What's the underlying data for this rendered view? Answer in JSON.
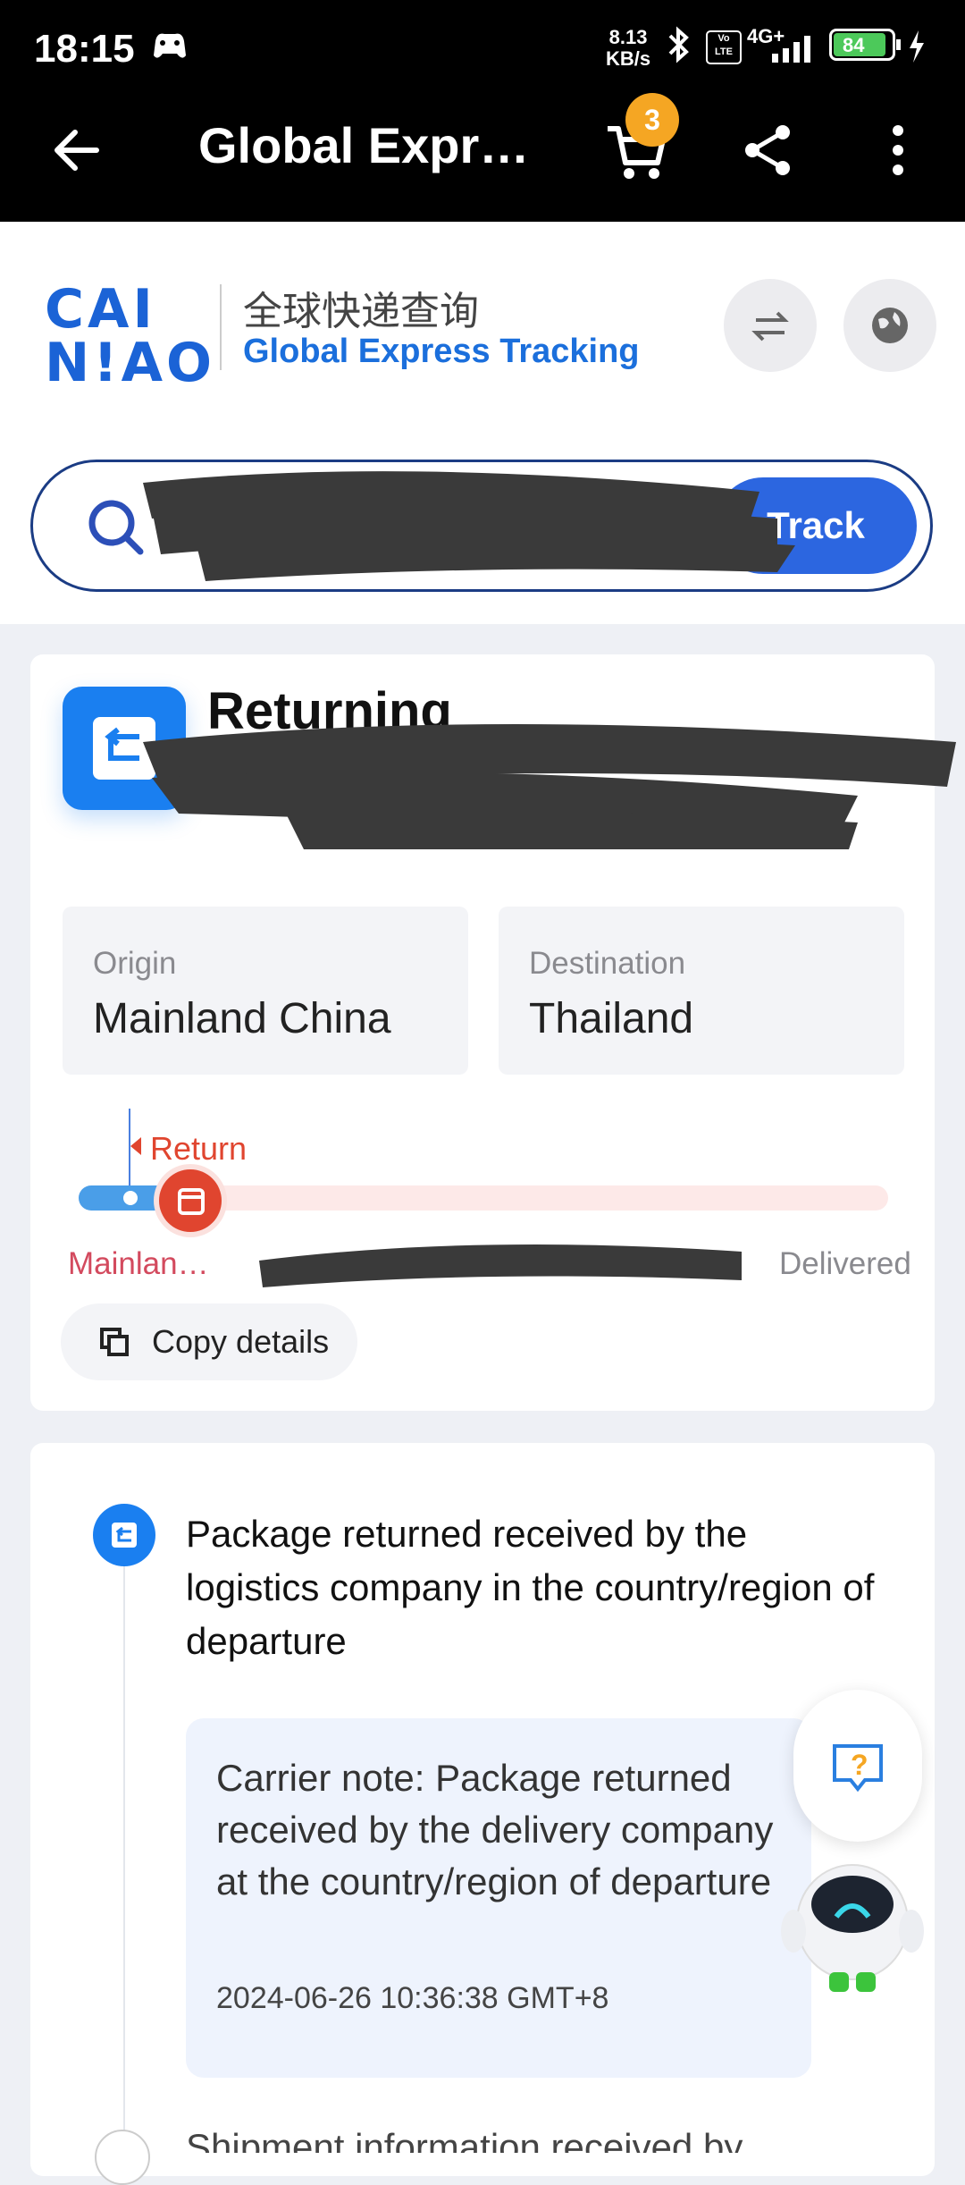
{
  "status_bar": {
    "time": "18:15",
    "net_speed_top": "8.13",
    "net_speed_bottom": "KB/s",
    "network": "4G+",
    "battery": "84"
  },
  "app_bar": {
    "title": "Global Expr…",
    "cart_count": "3"
  },
  "header": {
    "title_cn": "全球快递查询",
    "title_en": "Global Express Tracking",
    "logo_line1": "CAI",
    "logo_line2": "N!AO"
  },
  "search": {
    "track_label": "Track"
  },
  "status_card": {
    "status": "Returning",
    "origin_label": "Origin",
    "origin_value": "Mainland China",
    "destination_label": "Destination",
    "destination_value": "Thailand",
    "marker_label": "Return",
    "step_start": "Mainlan…",
    "step_end": "Delivered",
    "copy_label": "Copy details"
  },
  "timeline": {
    "event_title": "Package returned received by the logistics company in the country/region of departure",
    "note": "Carrier note: Package returned received by the delivery company at the country/region of departure",
    "timestamp": "2024-06-26 10:36:38 GMT+8",
    "next_event_partial": "Shipment information received by"
  },
  "colors": {
    "brand_blue": "#1b63d6",
    "return_red": "#e0452f",
    "cart_badge": "#f5a623"
  }
}
